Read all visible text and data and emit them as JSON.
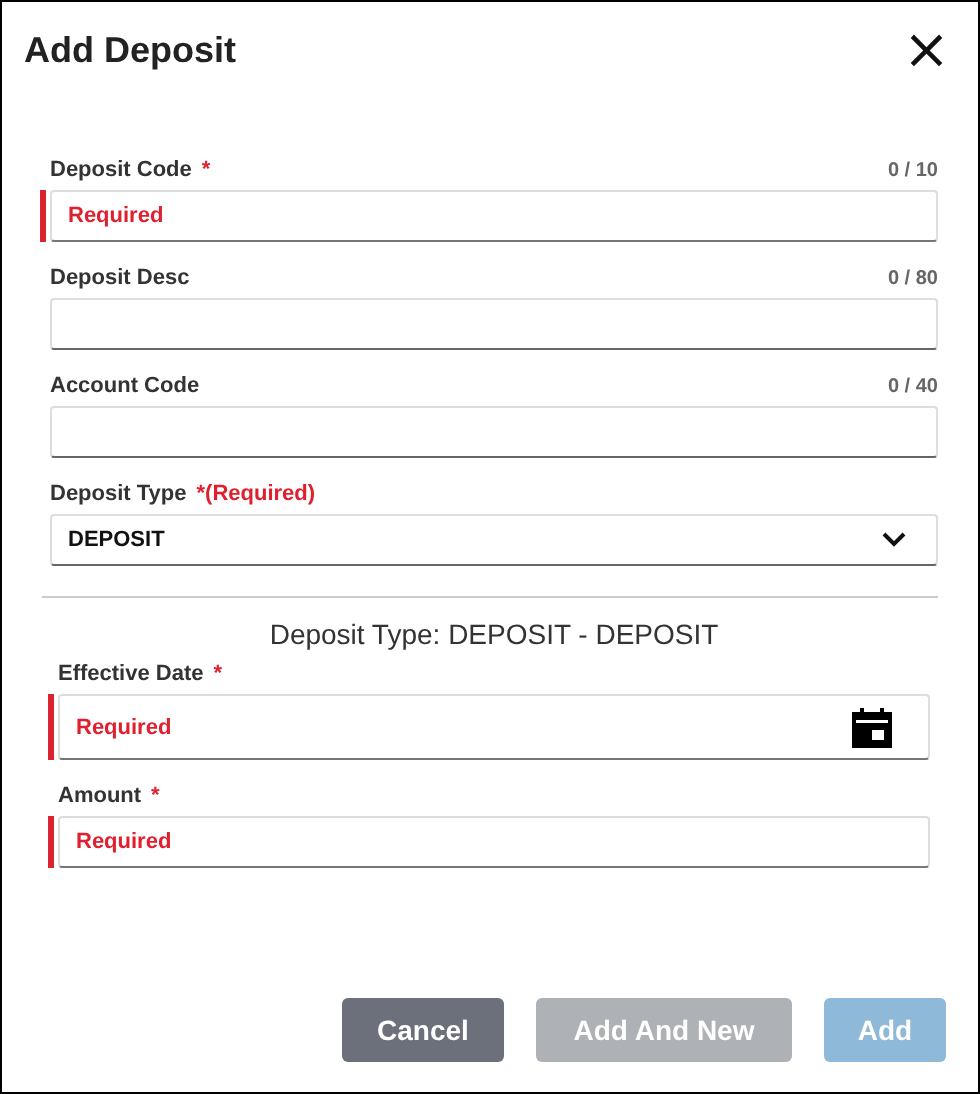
{
  "dialog": {
    "title": "Add Deposit",
    "close": "×"
  },
  "fields": [
    {
      "kind": "text",
      "label": "Deposit Code",
      "required_mark": "*",
      "counter": "0 / 10",
      "invalid": true,
      "placeholder": "Required"
    },
    {
      "kind": "text",
      "label": "Deposit Desc",
      "counter": "0 / 80",
      "invalid": false
    },
    {
      "kind": "text",
      "label": "Account Code",
      "counter": "0 / 40",
      "invalid": false
    },
    {
      "kind": "select",
      "label": "Deposit Type",
      "required_mark": "*(Required)",
      "value": "DEPOSIT",
      "invalid": false
    }
  ],
  "summary": "Deposit Type: DEPOSIT - DEPOSIT",
  "detail_fields": [
    {
      "kind": "date",
      "label": "Effective Date",
      "required_mark": "*",
      "invalid": true,
      "placeholder": "Required"
    },
    {
      "kind": "text",
      "label": "Amount",
      "required_mark": "*",
      "invalid": true,
      "placeholder": "Required"
    }
  ],
  "buttons": [
    {
      "label": "Cancel",
      "kind": "secondary",
      "disabled": false
    },
    {
      "label": "Add And New",
      "kind": "neutral",
      "disabled": true
    },
    {
      "label": "Add",
      "kind": "primary",
      "disabled": true
    }
  ]
}
